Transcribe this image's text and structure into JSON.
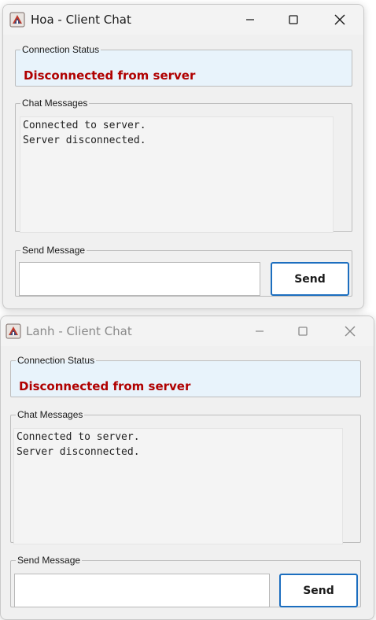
{
  "windows": [
    {
      "title": "Hoa - Client Chat",
      "icon": "java-app-icon",
      "connection_status": {
        "legend": "Connection Status",
        "text": "Disconnected from server",
        "color": "#b00000"
      },
      "chat": {
        "legend": "Chat Messages",
        "lines": [
          "Connected to server.",
          "Server disconnected."
        ]
      },
      "send": {
        "legend": "Send Message",
        "input_value": "",
        "button_label": "Send"
      }
    },
    {
      "title": "Lanh - Client Chat",
      "icon": "java-app-icon",
      "connection_status": {
        "legend": "Connection Status",
        "text": "Disconnected from server",
        "color": "#b00000"
      },
      "chat": {
        "legend": "Chat Messages",
        "lines": [
          "Connected to server.",
          "Server disconnected."
        ]
      },
      "send": {
        "legend": "Send Message",
        "input_value": "",
        "button_label": "Send"
      }
    }
  ],
  "colors": {
    "status_background": "#e8f3fb",
    "button_border": "#1c6ebf"
  }
}
